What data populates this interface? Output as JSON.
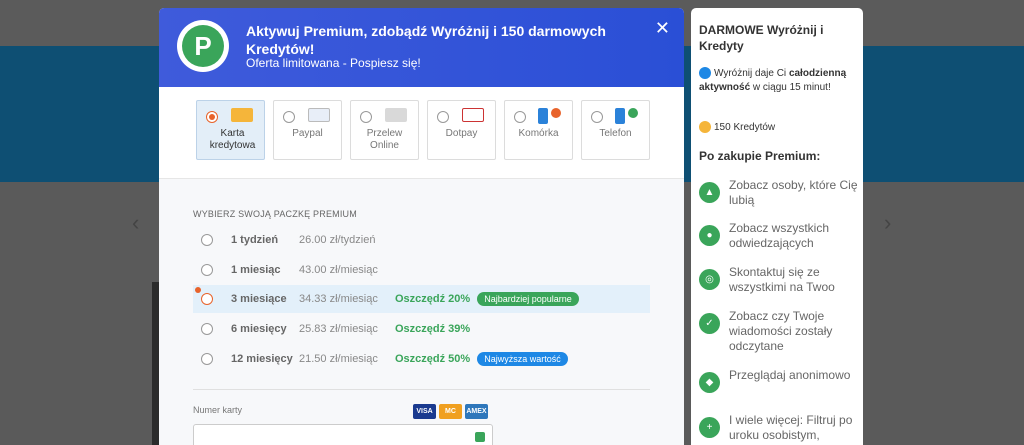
{
  "modal": {
    "title": "Aktywuj Premium, zdobądź Wyróżnij i 150 darmowych Kredytów!",
    "subtitle": "Oferta limitowana - Pospiesz się!",
    "logo_letter": "P",
    "close": "✕"
  },
  "methods": [
    {
      "label": "Karta kredytowa",
      "selected": true
    },
    {
      "label": "Paypal",
      "selected": false
    },
    {
      "label": "Przelew Online",
      "selected": false
    },
    {
      "label": "Dotpay",
      "selected": false
    },
    {
      "label": "Komórka",
      "selected": false
    },
    {
      "label": "Telefon",
      "selected": false
    }
  ],
  "packages_title": "WYBIERZ SWOJĄ PACZKĘ PREMIUM",
  "packages": [
    {
      "name": "1 tydzień",
      "price": "26.00 zł/tydzień",
      "save": "",
      "badge": ""
    },
    {
      "name": "1 miesiąc",
      "price": "43.00 zł/miesiąc",
      "save": "",
      "badge": ""
    },
    {
      "name": "3 miesiące",
      "price": "34.33 zł/miesiąc",
      "save": "Oszczędź 20%",
      "badge": "Najbardziej popularne"
    },
    {
      "name": "6 miesięcy",
      "price": "25.83 zł/miesiąc",
      "save": "Oszczędź 39%",
      "badge": ""
    },
    {
      "name": "12 miesięcy",
      "price": "21.50 zł/miesiąc",
      "save": "Oszczędź 50%",
      "badge": "Najwyższa wartość"
    }
  ],
  "card": {
    "label": "Numer karty",
    "value": "",
    "logos": [
      "VISA",
      "MC",
      "AMEX"
    ]
  },
  "colors": {
    "accent_orange": "#e8632b",
    "green": "#3aa55a",
    "badge_green": "#3aa55a",
    "badge_blue": "#1e88e5",
    "header": "#3f5bdb"
  },
  "side": {
    "title": "DARMOWE Wyróżnij i Kredyty",
    "feature1_pre": "Wyróżnij daje Ci ",
    "feature1_bold": "całodzienną aktywność",
    "feature1_post": " w ciągu 15 minut!",
    "feature2": "150 Kredytów",
    "after_title": "Po zakupie Premium:",
    "benefits": [
      "Zobacz osoby, które Cię lubią",
      "Zobacz wszystkich odwiedzających",
      "Skontaktuj się ze wszystkimi na Twoo",
      "Zobacz czy Twoje wiadomości zostały odczytane",
      "Przeglądaj anonimowo",
      "I wiele więcej: Filtruj po uroku osobistym,"
    ]
  }
}
